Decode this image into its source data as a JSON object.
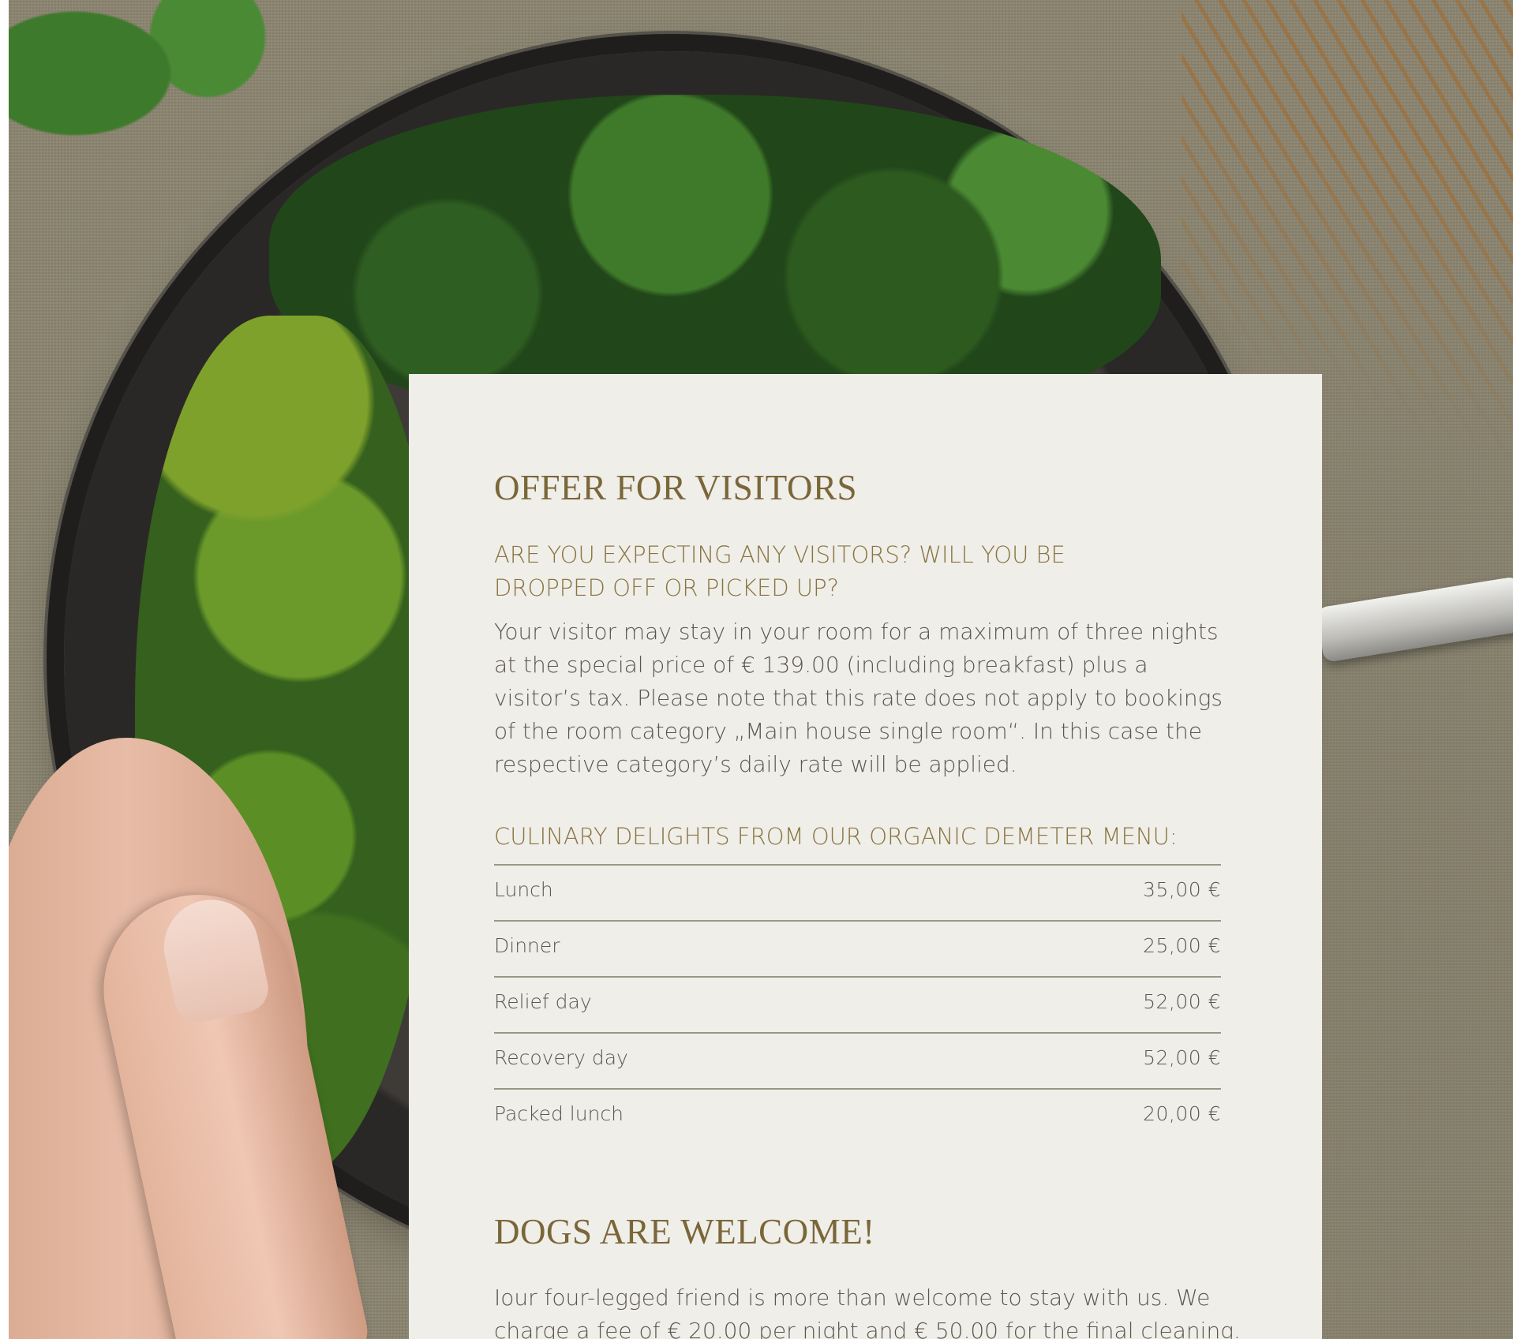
{
  "visitors": {
    "title": "OFFER FOR VISITORS",
    "subtitle": "ARE YOU EXPECTING ANY VISITORS? WILL YOU BE DROPPED OFF OR PICKED UP?",
    "body": "Your visitor may stay in your room for a maximum of three nights at the special price of € 139.00 (including breakfast) plus a visitor’s tax. Please note that this rate does not apply to bookings of the room category „Main house single room“. In this case the respective category’s daily rate will be applied."
  },
  "menu": {
    "heading": "CULINARY DELIGHTS FROM OUR ORGANIC DEMETER MENU:",
    "items": [
      {
        "label": "Lunch",
        "price": "35,00 €"
      },
      {
        "label": "Dinner",
        "price": "25,00 €"
      },
      {
        "label": "Relief day",
        "price": "52,00 €"
      },
      {
        "label": "Recovery day",
        "price": "52,00 €"
      },
      {
        "label": "Packed lunch",
        "price": "20,00 €"
      }
    ]
  },
  "dogs": {
    "title": "DOGS ARE WELCOME!",
    "body": "Iour four-legged friend is more than welcome to stay with us. We charge a fee of € 20.00 per night and € 50.00 for the final cleaning. Please"
  },
  "colors": {
    "card_background": "#efeee9",
    "heading_gold": "#7a6638",
    "subheading_gold": "#8a7440",
    "body_text": "#5b574f"
  }
}
